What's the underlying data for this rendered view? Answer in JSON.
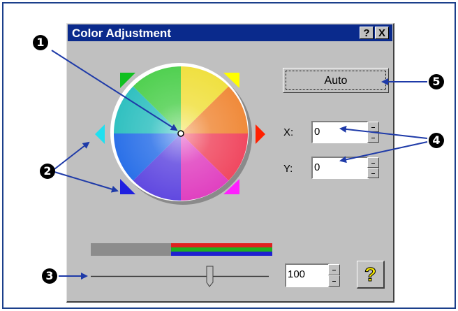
{
  "dialog": {
    "title": "Color Adjustment",
    "help_button_label": "?",
    "close_button_label": "X"
  },
  "auto_button": {
    "label": "Auto"
  },
  "coordinates": {
    "x": {
      "label": "X:",
      "value": "0"
    },
    "y": {
      "label": "Y:",
      "value": "0"
    }
  },
  "intensity": {
    "value": "100",
    "level": 100
  },
  "help_icon_glyph": "?",
  "callouts": [
    "1",
    "2",
    "3",
    "4",
    "5"
  ],
  "colors": {
    "frame_border": "#1b3f8b",
    "titlebar": "#0a2a8c",
    "dialog_face": "#c0c0c0",
    "arrow": "#1e3aa8",
    "help_icon": "#f5e600"
  }
}
